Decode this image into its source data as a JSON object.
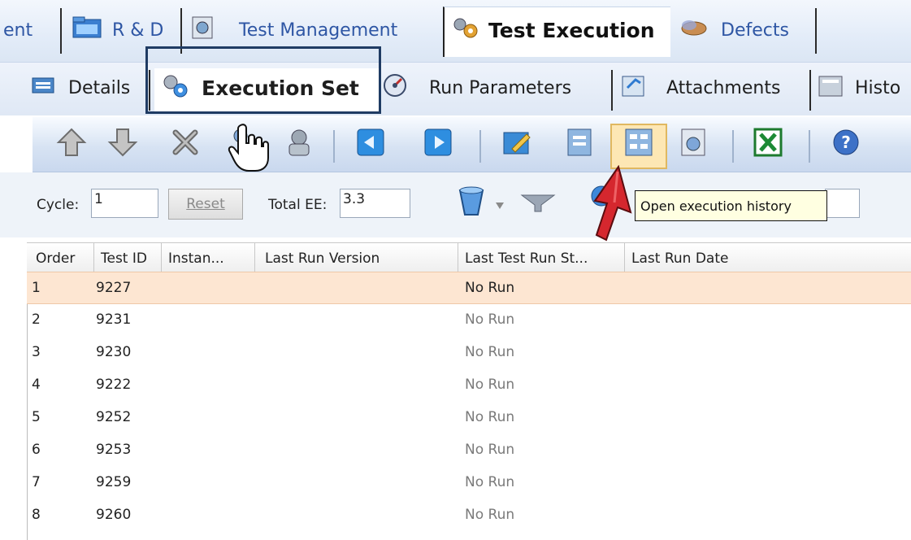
{
  "module_tabs": {
    "partial_label": "ent",
    "rd_label": "R & D",
    "test_management_label": "Test Management",
    "test_execution_label": "Test Execution",
    "defects_label": "Defects"
  },
  "sub_tabs": {
    "details_label": "Details",
    "execution_set_label": "Execution Set",
    "run_parameters_label": "Run Parameters",
    "attachments_label": "Attachments",
    "history_partial_label": "Histo"
  },
  "toolbar": {
    "icons": [
      "move-up-icon",
      "move-down-icon",
      "delete-icon",
      "run-icon",
      "run-automated-icon",
      "import-icon",
      "export-icon",
      "edit-icon",
      "report-icon",
      "execution-history-icon",
      "view-icon",
      "excel-icon",
      "help-icon"
    ],
    "highlight_color": "#fde7b4"
  },
  "filters": {
    "cycle_label": "Cycle:",
    "cycle_value": "1",
    "reset_label": "Reset",
    "total_ee_label": "Total EE:",
    "total_ee_value": "3.3"
  },
  "tooltip": {
    "text": "Open execution history"
  },
  "grid": {
    "columns": [
      "Order",
      "Test ID",
      "Instan...",
      "Last Run Version",
      "Last Test Run St...",
      "Last Run Date"
    ],
    "rows": [
      {
        "order": "1",
        "test_id": "9227",
        "status": "No Run"
      },
      {
        "order": "2",
        "test_id": "9231",
        "status": "No Run"
      },
      {
        "order": "3",
        "test_id": "9230",
        "status": "No Run"
      },
      {
        "order": "4",
        "test_id": "9222",
        "status": "No Run"
      },
      {
        "order": "5",
        "test_id": "9252",
        "status": "No Run"
      },
      {
        "order": "6",
        "test_id": "9253",
        "status": "No Run"
      },
      {
        "order": "7",
        "test_id": "9259",
        "status": "No Run"
      },
      {
        "order": "8",
        "test_id": "9260",
        "status": "No Run"
      }
    ],
    "selected_row_color": "#fde6d2"
  }
}
